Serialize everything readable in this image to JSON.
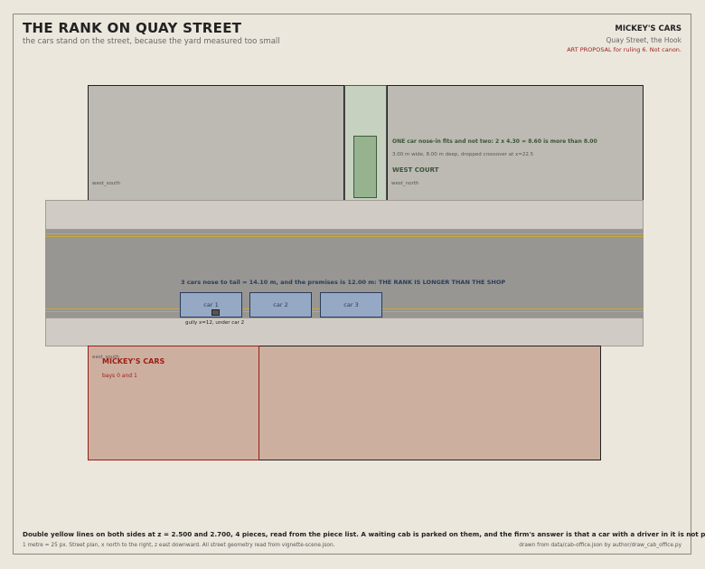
{
  "header": {
    "title": "THE RANK ON QUAY STREET",
    "subtitle": "the cars stand on the street, because the yard measured too small",
    "firm": "MICKEY'S CARS",
    "street": "Quay Street, the Hook",
    "proposal": "ART PROPOSAL for ruling 6. Not canon."
  },
  "plan": {
    "west_south_label": "west_south",
    "west_north_label": "west_north",
    "court": {
      "name": "WEST COURT",
      "fit_note": "ONE car nose-in fits and not two: 2 x 4.30 = 8.60 is more than 8.00",
      "dims_note": "3.00 m wide, 8.00 m deep, dropped crossover at x=22.5"
    },
    "rank_note": "3 cars nose to tail = 14.10 m, and the premises is 12.00 m: THE RANK IS LONGER THAN THE SHOP",
    "cars": [
      "car 1",
      "car 2",
      "car 3"
    ],
    "gully_label": "gully x=12, under car 2",
    "east_label": "east_south",
    "shop": {
      "name": "MICKEY'S CARS",
      "bays": "bays 0 and 1"
    }
  },
  "footer": {
    "caption": "Double yellow lines on both sides at z = 2.500 and 2.700, 4 pieces, read from the piece list. A waiting cab is parked on them, and the firm's answer is that a car with a driver in it is not parked.",
    "scale_note": "1 metre = 25 px. Street plan, x north to the right, z east downward. All street geometry read from vignette-scene.json.",
    "source_note": "drawn from data/cab-office.json by author/draw_cab_office.py"
  },
  "colors": {
    "background": "#ece7dd",
    "court_green": "#96b28f",
    "shop_red": "#9a1e14",
    "car_blue": "#95a8c4",
    "yellow_line": "#c9a83c"
  }
}
